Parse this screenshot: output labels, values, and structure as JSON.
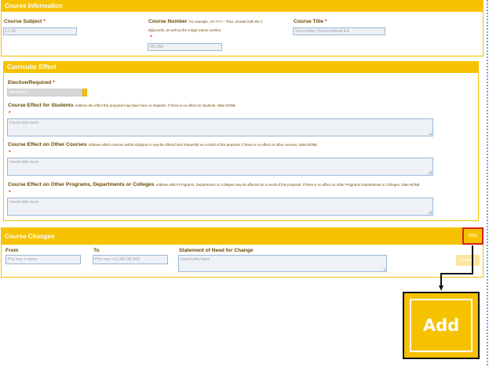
{
  "course_information": {
    "header": "Course Information",
    "subject_label": "Course Subject",
    "subject_value": "LLSE",
    "number_label": "Course Number",
    "number_hint_1": "For example, XX.YYY – Thus, include both the 2",
    "number_hint_2": "digit prefix, as well as the 3 digit course number.",
    "number_value": "08.150",
    "title_label": "Course Title",
    "title_value": "Secondary Sociocultural Ed",
    "required_mark": "*"
  },
  "curricular_effect": {
    "header": "Curricular Effect",
    "elective_label": "Elective/Required",
    "elective_value": "Required",
    "students_label": "Course Effect for Students",
    "students_hint": "Address the effect this proposal may have have on students. If there is no effect on students, state NONE.",
    "students_placeholder": "Insert info here",
    "other_courses_label": "Course Effect on Other Courses",
    "other_courses_hint": "Address which courses will be dropped or may be offered less frequently as a result of this proposal. If there is no effect on other courses, state NONE.",
    "other_courses_placeholder": "Insert info here",
    "other_programs_label": "Course Effect on Other Programs, Departments or Colleges",
    "other_programs_hint": "Address which Programs, Departments or Colleges may be affected as a result of this proposal. If there is no effect on other Programs Departments or Colleges, state NONE.",
    "other_programs_placeholder": "Insert info here",
    "required_mark": "*"
  },
  "course_changes": {
    "header": "Course Changes",
    "add_label": "Add",
    "from_label": "From",
    "from_value": "Pre-req = none",
    "to_label": "To",
    "to_value": "Pre-req = LLSE 08.100",
    "statement_label": "Statement of Need for Change",
    "statement_placeholder": "Insert info here",
    "remove_label": "Remove"
  },
  "callout": {
    "label": "Add"
  },
  "colors": {
    "accent": "#f6c200",
    "highlight_border": "#d42020",
    "label_text": "#6b4a00",
    "field_border": "#9ab8d6"
  }
}
